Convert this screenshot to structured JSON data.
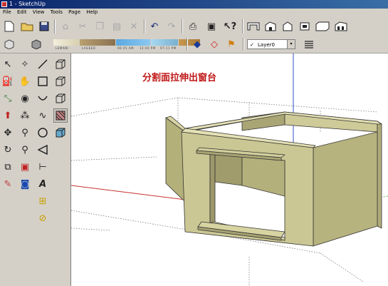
{
  "window": {
    "title": "1 - SketchUp"
  },
  "menu": [
    "File",
    "Edit",
    "View",
    "Tools",
    "Page",
    "Help"
  ],
  "toolbar": {
    "materials": [
      {
        "label": "LEMANI",
        "color": "#e8e0c8"
      },
      {
        "label": "LAGEED",
        "color": "#b8a070"
      },
      {
        "label": "06:45 AM",
        "color": "#5aa8e0"
      },
      {
        "label": "12:00 PM",
        "color": "#a8d8f0"
      },
      {
        "label": "07:11 PM",
        "color": "#c89850"
      }
    ],
    "layer": {
      "check": "✓",
      "name": "Layer0",
      "dropdown": "▾"
    }
  },
  "viewport": {
    "caption": "分割面拉伸出窗台",
    "model_color": "#c8c48e",
    "axis_red": "#c83030",
    "axis_green": "#30a030",
    "axis_blue": "#3050c8"
  }
}
